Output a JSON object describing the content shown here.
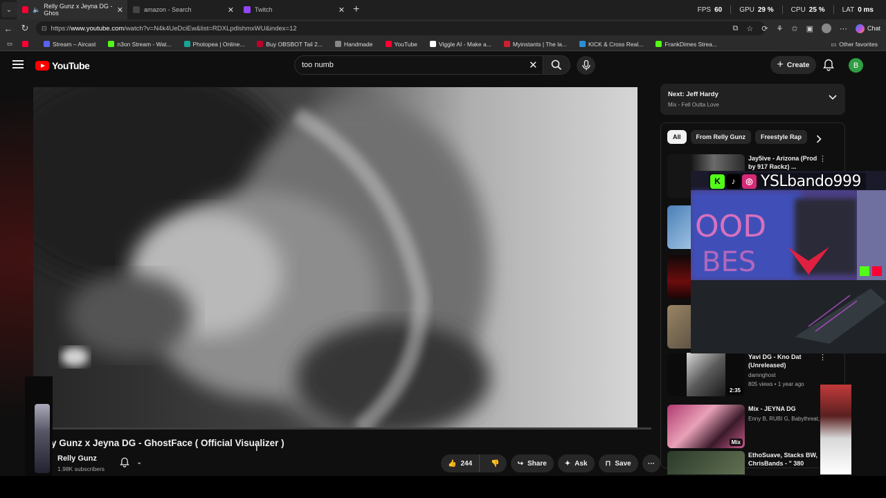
{
  "browser": {
    "tabs": [
      {
        "title": "Relly Gunz x Jeyna DG - Ghos",
        "color": "#ff0033"
      },
      {
        "title": "amazon - Search",
        "color": "#444444"
      },
      {
        "title": "Twitch",
        "color": "#9146ff"
      }
    ],
    "perf": {
      "fps_label": "FPS",
      "fps": "60",
      "gpu_label": "GPU",
      "gpu": "29 %",
      "cpu_label": "CPU",
      "cpu": "25 %",
      "lat_label": "LAT",
      "lat": "0 ms"
    },
    "url_host": "www.youtube.com",
    "url_prefix": "https://",
    "url_path": "/watch?v=N4k4UeDciEw&list=RDXLpdlshmxWU&index=12",
    "chat_label": "Chat",
    "bookmarks": [
      {
        "label": "",
        "color": "#ff0033"
      },
      {
        "label": "Stream – Aircast",
        "color": "#5865f2"
      },
      {
        "label": "n3on Stream - Wat...",
        "color": "#53fc18"
      },
      {
        "label": "Photopea | Online...",
        "color": "#18a497"
      },
      {
        "label": "Buy OBSBOT Tail 2...",
        "color": "#c0002a"
      },
      {
        "label": "Handmade",
        "color": "#888888"
      },
      {
        "label": "YouTube",
        "color": "#ff0033"
      },
      {
        "label": "Viggle AI - Make a...",
        "color": "#ffffff"
      },
      {
        "label": "Myinstants | The la...",
        "color": "#d01f2f"
      },
      {
        "label": "KICK & Cross Real...",
        "color": "#2b8fd6"
      },
      {
        "label": "FrankDimes Strea...",
        "color": "#53fc18"
      }
    ],
    "other_favorites": "Other favorites"
  },
  "youtube": {
    "logo_text": "YouTube",
    "search_value": "too numb",
    "create_label": "Create",
    "profile_initial": "B",
    "video_title": "y Gunz x Jeyna DG - GhostFace ( Official Visualizer )",
    "channel_name": "Relly Gunz",
    "subscribers": "1.98K subscribers",
    "likes": "244",
    "share_label": "Share",
    "ask_label": "Ask",
    "save_label": "Save",
    "next_title": "Next: Jeff Hardy",
    "next_sub": "Mix - Fell Outta Love",
    "chips": [
      "All",
      "From Relly Gunz",
      "Freestyle Rap"
    ],
    "recs": [
      {
        "title": "Jay5ive - Arizona (Prod by 917 Rackz) ...",
        "meta1": "",
        "meta2": "",
        "duration": ""
      },
      {
        "title": "Yavi DG - Kno Dat (Unreleased)",
        "meta1": "damnghost",
        "meta2": "805 views • 1 year ago",
        "duration": "2:35"
      },
      {
        "title": "Mix - JEYNA DG",
        "meta1": "Enny B, RUBI G, Babythreat, a",
        "meta2": "",
        "duration": "Mix"
      },
      {
        "title": "EthoSuave, Stacks BW, ChrisBands - \" 380",
        "meta1": "",
        "meta2": "",
        "duration": ""
      }
    ]
  },
  "overlay": {
    "handle": "YSLbando999",
    "kick_color": "#53fc18",
    "tiktok_color": "#000000",
    "instagram_color": "#d62976"
  }
}
